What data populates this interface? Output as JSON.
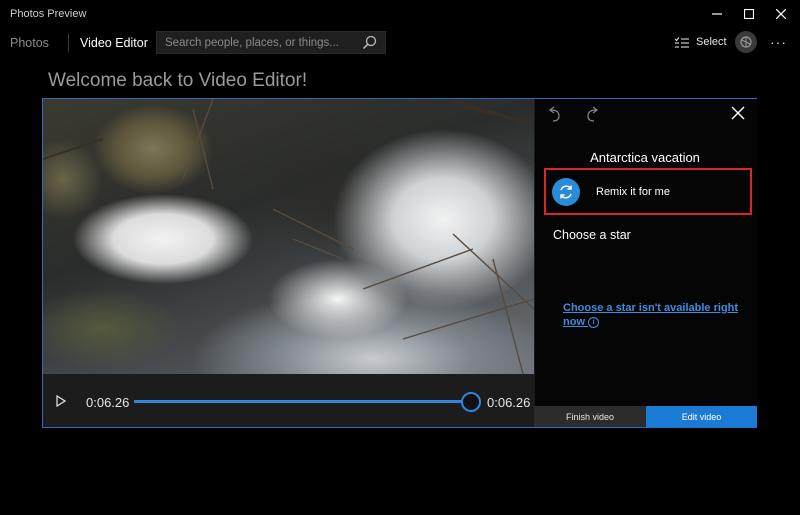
{
  "window": {
    "title": "Photos Preview",
    "controls": [
      "minimize-icon",
      "maximize-icon",
      "close-icon"
    ]
  },
  "nav": {
    "tabs": [
      {
        "label": "Photos",
        "active": false
      },
      {
        "label": "Video Editor",
        "active": true
      }
    ],
    "search": {
      "placeholder": "Search people, places, or things...",
      "value": ""
    },
    "select_label": "Select",
    "more_label": "···"
  },
  "header": {
    "welcome": "Welcome back to Video Editor!"
  },
  "player": {
    "current_time": "0:06.26",
    "total_time": "0:06.26",
    "progress": 1.0
  },
  "panel": {
    "project_title": "Antarctica vacation",
    "remix_label": "Remix it for me",
    "star_heading": "Choose a star",
    "star_link": "Choose a star isn't available right now",
    "finish_label": "Finish video",
    "edit_label": "Edit video"
  },
  "colors": {
    "accent": "#1a7bd7",
    "highlight_border": "#d7262e",
    "link": "#3c8de0",
    "frame_border": "#2d6dbf"
  }
}
